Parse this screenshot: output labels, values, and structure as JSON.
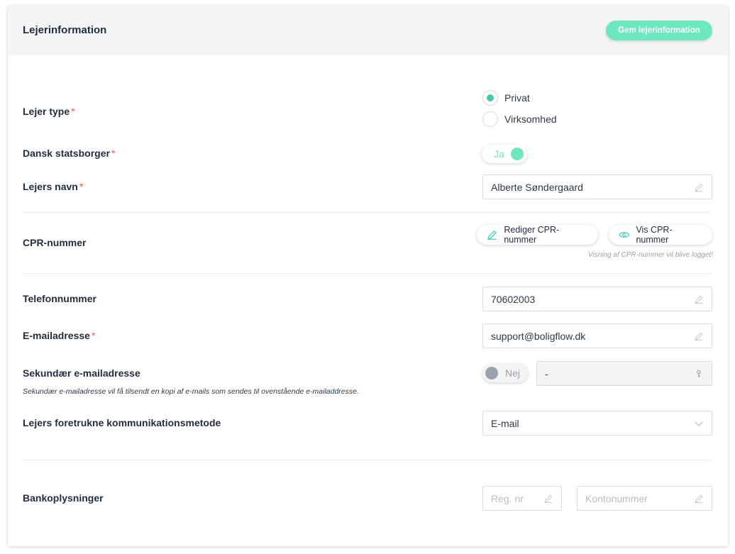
{
  "header": {
    "title": "Lejerinformation",
    "save_label": "Gem lejerinformation"
  },
  "tenant_type": {
    "label": "Lejer type",
    "required_mark": "*",
    "options": [
      {
        "label": "Privat",
        "selected": true
      },
      {
        "label": "Virksomhed",
        "selected": false
      }
    ]
  },
  "danish_citizen": {
    "label": "Dansk statsborger",
    "required_mark": "*",
    "toggle_text": "Ja",
    "value": true
  },
  "tenant_name": {
    "label": "Lejers navn",
    "required_mark": "*",
    "value": "Alberte Søndergaard"
  },
  "cpr": {
    "label": "CPR-nummer",
    "edit_label": "Rediger CPR-nummer",
    "view_label": "Vis CPR-nummer",
    "note": "Visning af CPR-nummer vil blive logget!"
  },
  "phone": {
    "label": "Telefonnummer",
    "value": "70602003"
  },
  "email": {
    "label": "E-mailadresse",
    "required_mark": "*",
    "value": "support@boligflow.dk"
  },
  "secondary_email": {
    "label": "Sekundær e-mailadresse",
    "toggle_text": "Nej",
    "value_toggle": false,
    "value": "-",
    "note": "Sekundær e-mailadresse vil få tilsendt en kopi af e-mails som sendes til ovenstående e-mailaddresse."
  },
  "communication": {
    "label": "Lejers foretrukne kommunikationsmetode",
    "selected": "E-mail"
  },
  "bank": {
    "label": "Bankoplysninger",
    "reg_placeholder": "Reg. nr",
    "account_placeholder": "Kontonummer"
  },
  "colors": {
    "accent": "#6ee6c0",
    "radio_accent": "#45c8b2",
    "required": "#ef5b4a",
    "header_bg": "#f4f5f7"
  }
}
